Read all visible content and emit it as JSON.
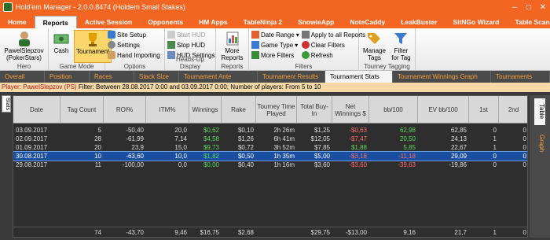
{
  "window": {
    "title": "Hold'em Manager - 2.0.0.8474 (Holdem Small Stakes)"
  },
  "ribbon_tabs": [
    "Home",
    "Reports",
    "Active Session",
    "Opponents",
    "HM Apps",
    "TableNinja 2",
    "SnowieApp",
    "NoteCaddy",
    "LeakBuster",
    "SitNGo Wizard",
    "Table Scanner 2"
  ],
  "ribbon": {
    "hero": {
      "label": "PawelSlepzov (PokerStars)",
      "group": "Hero"
    },
    "game_mode": {
      "cash": "Cash",
      "tournament": "Tournament",
      "group": "Game Mode"
    },
    "options": {
      "site_setup": "Site Setup",
      "settings": "Settings",
      "hand_importing": "Hand Importing",
      "group": "Options"
    },
    "hud": {
      "start": "Start HUD",
      "stop": "Stop HUD",
      "settings": "HUD Settings",
      "group": "Heads-Up Display"
    },
    "reports": {
      "more": "More Reports",
      "group": "Reports"
    },
    "filters": {
      "date_range": "Date Range",
      "game_type": "Game Type",
      "more_filters": "More Filters",
      "apply_all": "Apply to all Reports",
      "clear": "Clear Filters",
      "refresh": "Refresh",
      "group": "Filters"
    },
    "tagging": {
      "manage": "Manage Tags",
      "filter": "Filter for Tag",
      "group": "Tourney Tagging"
    }
  },
  "doc_tabs": [
    "Overall",
    "Position",
    "Races",
    "Stack Size",
    "Tournament Ante",
    "Tournament Results",
    "Tournament Stats",
    "Tournament Winnings Graph",
    "Tournaments"
  ],
  "filterbar": {
    "player": "Player: PawelSlepzov (PS)",
    "filter": "Filter: Between 28.08.2017 0:00 and 03.09.2017 0:00; Number of players: From 5 to 10"
  },
  "side_left": "Stats",
  "side_right": {
    "table": "Table",
    "graph": "Graph"
  },
  "table": {
    "headers": [
      "Date",
      "Tag Count",
      "ROI%",
      "ITM%",
      "Winnings",
      "Rake",
      "Tourney Time Played",
      "Total Buy-In",
      "Net Winnings $",
      "bb/100",
      "EV bb/100",
      "1st",
      "2nd"
    ],
    "rows": [
      [
        "03.09.2017",
        "5",
        "-50,40",
        "20,0",
        "$0,62",
        "$0,10",
        "2h 26m",
        "$1,25",
        "-$0,63",
        "62,98",
        "62,85",
        "0",
        "0"
      ],
      [
        "02.09.2017",
        "28",
        "-61,99",
        "7,14",
        "$4,58",
        "$1,26",
        "6h 41m",
        "$12,05",
        "-$7,47",
        "20,50",
        "24,13",
        "1",
        "0"
      ],
      [
        "01.09.2017",
        "20",
        "23,9",
        "15,0",
        "$9,73",
        "$0,72",
        "3h 52m",
        "$7,85",
        "$1,88",
        "5,85",
        "22,67",
        "1",
        "0"
      ],
      [
        "30.08.2017",
        "10",
        "-63,60",
        "10,0",
        "$1,82",
        "$0,50",
        "1h 35m",
        "$5,00",
        "-$3,18",
        "-11,18",
        "29,09",
        "0",
        "0"
      ],
      [
        "29.08.2017",
        "11",
        "-100,00",
        "0,0",
        "$0,00",
        "$0,40",
        "1h 16m",
        "$3,60",
        "-$3,60",
        "-39,63",
        "-19,86",
        "0",
        "0"
      ]
    ],
    "totals": [
      "74",
      "-43,70",
      "9,46",
      "$16,75",
      "$2,68",
      "$29,75",
      "-$13,00",
      "9,16",
      "21,7",
      "1",
      "0"
    ]
  }
}
